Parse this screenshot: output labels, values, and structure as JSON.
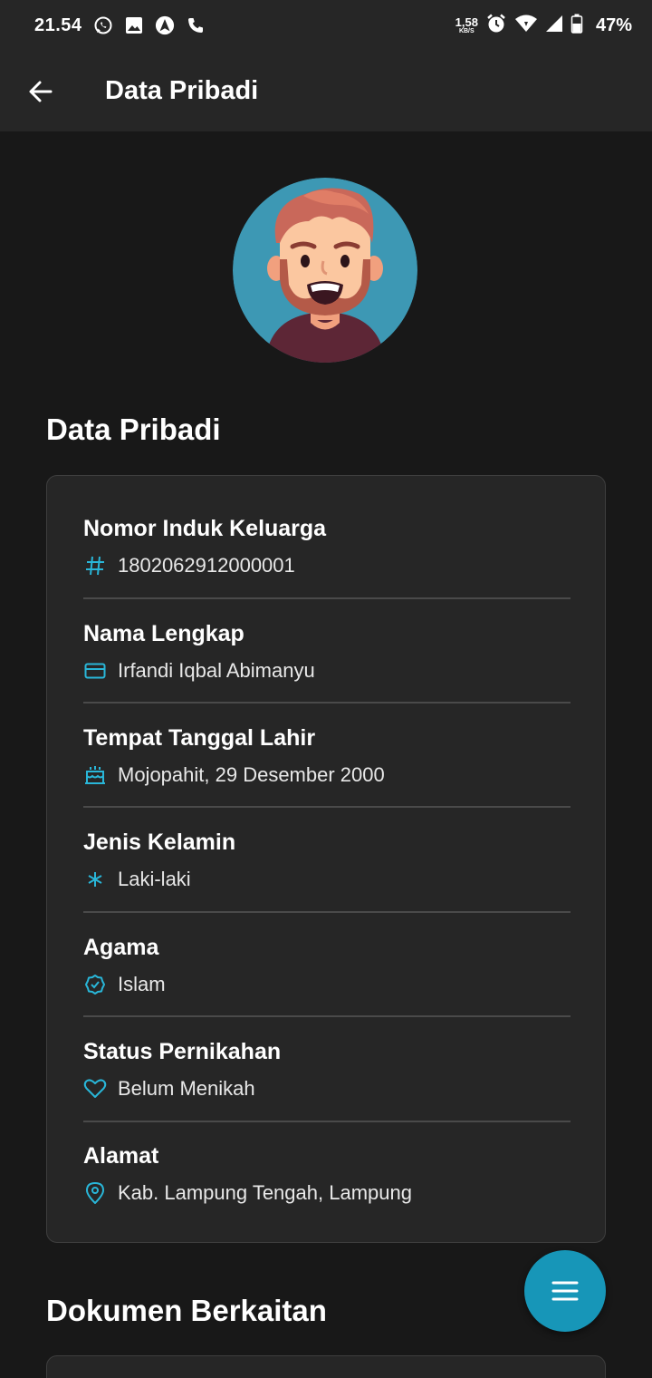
{
  "status_bar": {
    "time": "21.54",
    "net_speed_value": "1,58",
    "net_speed_unit": "KB/S",
    "battery": "47%",
    "left_icons": [
      "whatsapp-icon",
      "image-icon",
      "navigation-icon",
      "phone-icon"
    ],
    "right_icons": [
      "alarm-icon",
      "wifi-icon",
      "signal-icon",
      "battery-icon"
    ]
  },
  "app_bar": {
    "title": "Data Pribadi",
    "back_icon": "arrow-left-icon"
  },
  "section_personal": {
    "title": "Data Pribadi"
  },
  "fields": [
    {
      "label": "Nomor Induk Keluarga",
      "value": "1802062912000001",
      "icon": "hash-icon"
    },
    {
      "label": "Nama Lengkap",
      "value": "Irfandi Iqbal Abimanyu",
      "icon": "id-card-icon"
    },
    {
      "label": "Tempat Tanggal Lahir",
      "value": "Mojopahit, 29 Desember 2000",
      "icon": "cake-icon"
    },
    {
      "label": "Jenis Kelamin",
      "value": "Laki-laki",
      "icon": "asterisk-icon"
    },
    {
      "label": "Agama",
      "value": "Islam",
      "icon": "verified-badge-icon"
    },
    {
      "label": "Status Pernikahan",
      "value": "Belum Menikah",
      "icon": "heart-icon"
    },
    {
      "label": "Alamat",
      "value": "Kab. Lampung Tengah, Lampung",
      "icon": "location-pin-icon"
    }
  ],
  "section_documents": {
    "title": "Dokumen Berkaitan"
  },
  "fab": {
    "icon": "menu-icon"
  },
  "colors": {
    "background": "#181818",
    "surface": "#262626",
    "accent": "#1796b8",
    "icon_accent": "#29b6d8",
    "avatar_bg": "#3d98b4"
  }
}
